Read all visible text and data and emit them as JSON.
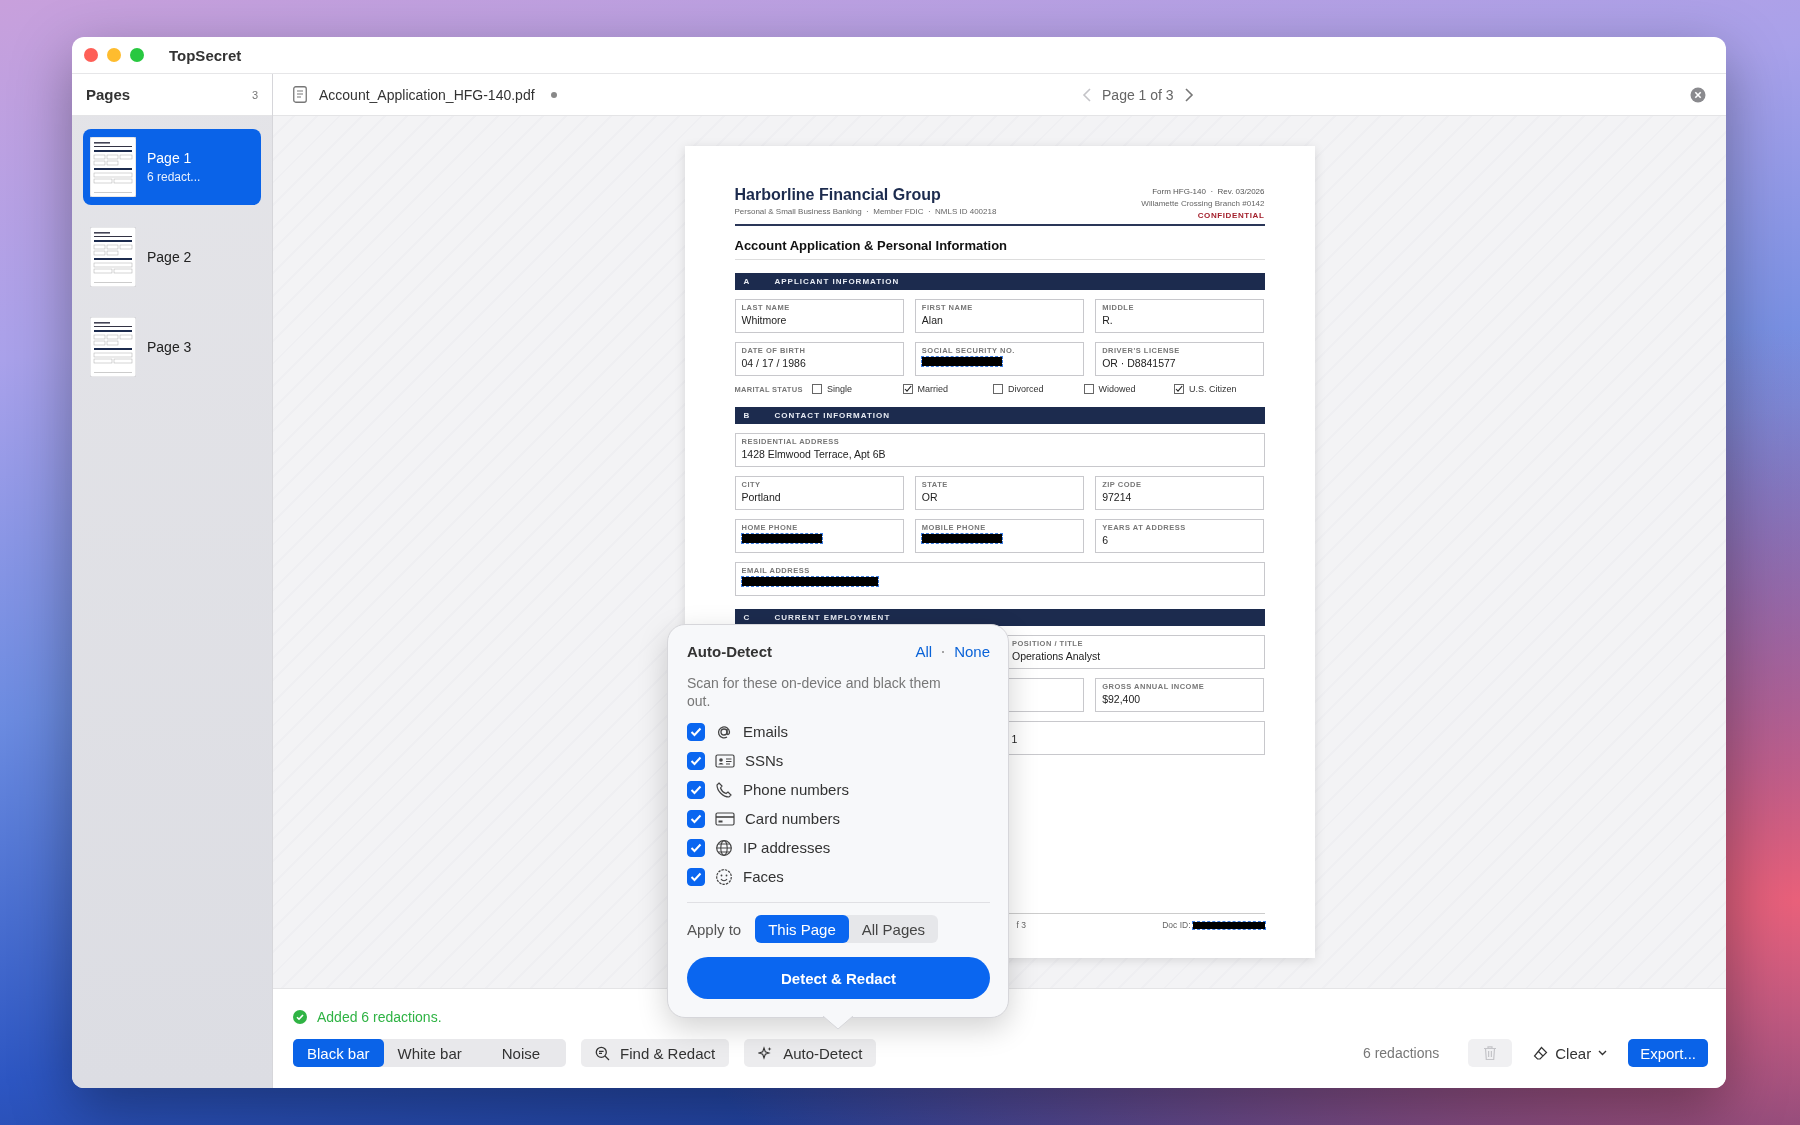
{
  "window": {
    "title": "TopSecret"
  },
  "sidebar": {
    "title": "Pages",
    "count": "3",
    "pages": [
      {
        "label": "Page 1",
        "subtitle": "6 redact...",
        "selected": true
      },
      {
        "label": "Page 2",
        "selected": false
      },
      {
        "label": "Page 3",
        "selected": false
      }
    ]
  },
  "document_bar": {
    "filename": "Account_Application_HFG-140.pdf",
    "unsaved": true,
    "page_indicator": "Page 1 of 3",
    "prev_disabled": true
  },
  "document": {
    "company": "Harborline Financial Group",
    "tagline": "Personal & Small Business Banking  ·  Member FDIC  ·  NMLS ID 400218",
    "form": "Form HFG-140  ·  Rev. 03/2026",
    "branch": "Willamette Crossing Branch #0142",
    "classification": "CONFIDENTIAL",
    "title": "Account Application & Personal Information",
    "sections": [
      {
        "letter": "A",
        "title": "APPLICANT INFORMATION",
        "rows": [
          {
            "kind": "fields",
            "fields": [
              {
                "label": "LAST NAME",
                "value": "Whitmore"
              },
              {
                "label": "FIRST NAME",
                "value": "Alan"
              },
              {
                "label": "MIDDLE",
                "value": "R."
              }
            ]
          },
          {
            "kind": "fields",
            "fields": [
              {
                "label": "DATE OF BIRTH",
                "value": "04 / 17 / 1986"
              },
              {
                "label": "SOCIAL SECURITY NO.",
                "redacted": true
              },
              {
                "label": "DRIVER'S LICENSE",
                "value": "OR · D8841577"
              }
            ]
          },
          {
            "kind": "checks",
            "label": "MARITAL STATUS",
            "options": [
              {
                "label": "Single",
                "checked": false
              },
              {
                "label": "Married",
                "checked": true
              },
              {
                "label": "Divorced",
                "checked": false
              },
              {
                "label": "Widowed",
                "checked": false
              },
              {
                "label": "U.S. Citizen",
                "checked": true
              }
            ]
          }
        ]
      },
      {
        "letter": "B",
        "title": "CONTACT INFORMATION",
        "rows": [
          {
            "kind": "fields",
            "fields": [
              {
                "label": "RESIDENTIAL ADDRESS",
                "value": "1428 Elmwood Terrace, Apt 6B"
              }
            ]
          },
          {
            "kind": "fields",
            "fields": [
              {
                "label": "CITY",
                "value": "Portland"
              },
              {
                "label": "STATE",
                "value": "OR"
              },
              {
                "label": "ZIP CODE",
                "value": "97214"
              }
            ]
          },
          {
            "kind": "fields",
            "fields": [
              {
                "label": "HOME PHONE",
                "redacted": true
              },
              {
                "label": "MOBILE PHONE",
                "redacted": true
              },
              {
                "label": "YEARS AT ADDRESS",
                "value": "6"
              }
            ]
          },
          {
            "kind": "fields",
            "fields": [
              {
                "label": "EMAIL ADDRESS",
                "redacted": true
              }
            ]
          }
        ]
      },
      {
        "letter": "C",
        "title": "CURRENT EMPLOYMENT",
        "rows": [
          {
            "kind": "offset",
            "fields": [
              {
                "kind": "field",
                "label": "POSITION / TITLE",
                "value": "Operations Analyst"
              }
            ]
          },
          {
            "kind": "offset",
            "fields": [
              {
                "kind": "covered"
              },
              {
                "kind": "field",
                "label": "GROSS ANNUAL INCOME",
                "value": "$92,400"
              }
            ]
          },
          {
            "kind": "fields",
            "fields": [
              {
                "kind": "field",
                "tail": "1"
              }
            ]
          }
        ]
      }
    ],
    "footer": {
      "page": "f 3",
      "doc_id_label": "Doc ID:",
      "doc_id_redacted": true
    }
  },
  "popover": {
    "title": "Auto-Detect",
    "select_all": "All",
    "select_none": "None",
    "description": "Scan for these on-device and black them out.",
    "items": [
      {
        "label": "Emails",
        "checked": true
      },
      {
        "label": "SSNs",
        "checked": true
      },
      {
        "label": "Phone numbers",
        "checked": true
      },
      {
        "label": "Card numbers",
        "checked": true
      },
      {
        "label": "IP addresses",
        "checked": true
      },
      {
        "label": "Faces",
        "checked": true
      }
    ],
    "apply_label": "Apply to",
    "scopes": [
      {
        "label": "This Page",
        "selected": true
      },
      {
        "label": "All Pages",
        "selected": false
      }
    ],
    "action": "Detect & Redact"
  },
  "toolbar": {
    "status": "Added 6 redactions.",
    "styles": [
      {
        "label": "Black bar",
        "selected": true
      },
      {
        "label": "White bar",
        "selected": false
      },
      {
        "label": "Noise",
        "selected": false
      }
    ],
    "tools": [
      {
        "label": "Find & Redact"
      },
      {
        "label": "Auto-Detect"
      }
    ],
    "count": "6 redactions",
    "delete_disabled": true,
    "clear": "Clear",
    "export": "Export..."
  }
}
